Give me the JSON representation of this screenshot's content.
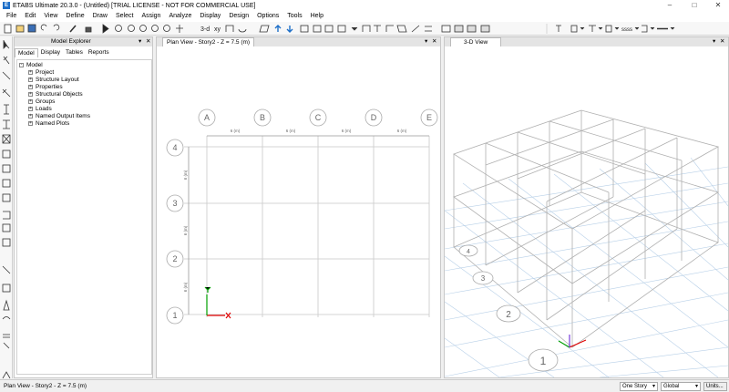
{
  "window": {
    "title": "ETABS Ultimate 20.3.0 - (Untitled)  [TRIAL LICENSE - NOT FOR COMMERCIAL USE]",
    "app_icon_letter": "E",
    "controls": [
      "minimize-icon",
      "maximize-icon",
      "close-icon"
    ]
  },
  "menu": [
    "File",
    "Edit",
    "View",
    "Define",
    "Draw",
    "Select",
    "Assign",
    "Analyze",
    "Display",
    "Design",
    "Options",
    "Tools",
    "Help"
  ],
  "toolbar": {
    "view_3d_label": "3-d",
    "view_plan_label": "xy",
    "line_style_label": "ssss"
  },
  "explorer": {
    "title": "Model Explorer",
    "pin": "▾",
    "close": "✕",
    "tabs": [
      "Model",
      "Display",
      "Tables",
      "Reports"
    ],
    "root": "Model",
    "items": [
      "Project",
      "Structure Layout",
      "Properties",
      "Structural Objects",
      "Groups",
      "Loads",
      "Named Output Items",
      "Named Plots"
    ]
  },
  "plan_view": {
    "title": "Plan View - Story2 - Z = 7.5 (m)",
    "grid_x": [
      "A",
      "B",
      "C",
      "D",
      "E"
    ],
    "grid_y": [
      "1",
      "2",
      "3",
      "4"
    ],
    "spacing_x_label": "6 (m)",
    "spacing_y_label": "6 (m)"
  },
  "view_3d": {
    "title": "3-D View",
    "grid_y": [
      "1",
      "2",
      "3",
      "4"
    ]
  },
  "status": {
    "left": "Plan View - Story2 - Z = 7.5 (m)",
    "story_select": "One Story",
    "coord_select": "Global",
    "units_button": "Units..."
  },
  "colors": {
    "accent": "#1e6fc8",
    "grid": "#c8c8c8",
    "axis_x": "#e00000",
    "axis_y": "#00a000",
    "axis_z": "#6a2ad8",
    "grid_3d": "#b8d0e8"
  }
}
